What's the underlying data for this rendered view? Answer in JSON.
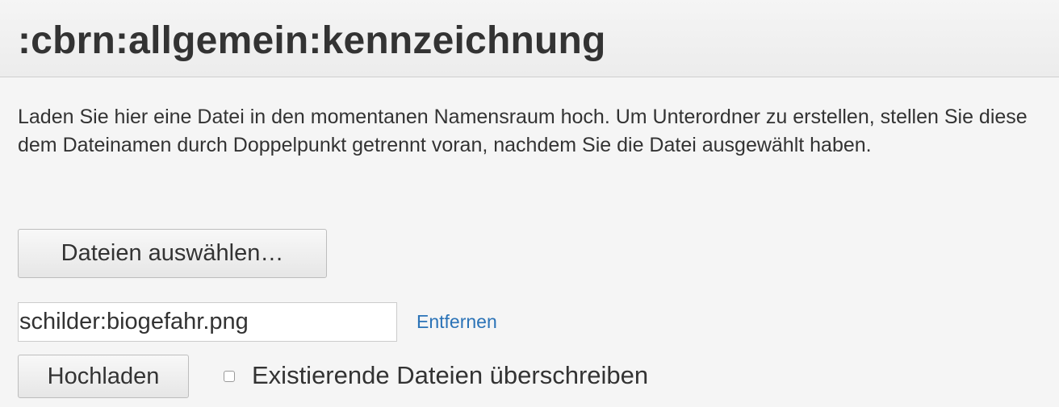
{
  "page": {
    "title": ":cbrn:allgemein:kennzeichnung"
  },
  "upload": {
    "description": "Laden Sie hier eine Datei in den momentanen Namensraum hoch. Um Unterordner zu erstellen, stellen Sie diese dem Dateinamen durch Doppelpunkt getrennt voran, nachdem Sie die Datei ausgewählt haben.",
    "choose_files_label": "Dateien auswählen…",
    "file_name_value": "schilder:biogefahr.png",
    "remove_label": "Entfernen",
    "upload_label": "Hochladen",
    "overwrite_label": "Existierende Dateien überschreiben",
    "overwrite_checked": false
  },
  "colors": {
    "background": "#f5f5f5",
    "text": "#333333",
    "link": "#2b73b7",
    "border": "#cccccc"
  }
}
